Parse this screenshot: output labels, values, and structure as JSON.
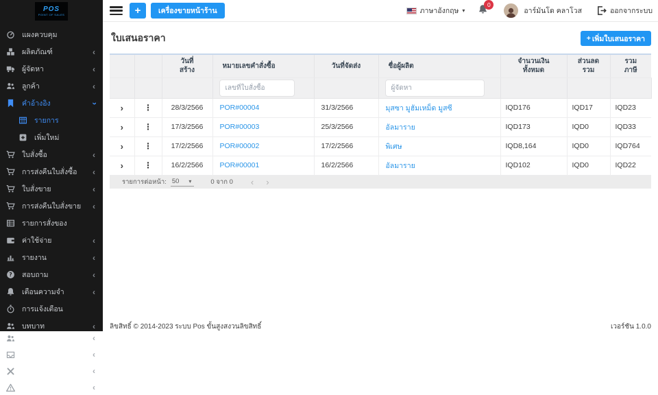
{
  "glyphs": {
    "plus": "+",
    "expand": "›",
    "dots": "⋮",
    "chevron": "‹",
    "caret": "▾",
    "prev": "‹",
    "next": "›"
  },
  "brand": {
    "name": "POS",
    "tagline": "POINT OF SALES"
  },
  "topbar": {
    "pos_terminal_button": "เครื่องขายหน้าร้าน",
    "language_label": "ภาษาอังกฤษ",
    "notification_badge": "0",
    "user_name": "อาร์มันโด คลาโวส",
    "logout_label": "ออกจากระบบ"
  },
  "sidebar": {
    "items": [
      {
        "icon": "dashboard",
        "label": "แผงควบคุม"
      },
      {
        "icon": "products",
        "label": "ผลิตภัณฑ์"
      },
      {
        "icon": "supplier-truck",
        "label": "ผู้จัดหา"
      },
      {
        "icon": "customers",
        "label": "ลูกค้า"
      },
      {
        "icon": "bookmark",
        "label": "คำอ้างอิง",
        "active": true
      },
      {
        "icon": "table",
        "label": "รายการ",
        "active": true,
        "sub": true
      },
      {
        "icon": "plus-square",
        "label": "เพิ่มใหม่",
        "sub": true
      },
      {
        "icon": "cart",
        "label": "ใบสั่งซื้อ"
      },
      {
        "icon": "cart-return",
        "label": "การส่งคืนใบสั่งซื้อ"
      },
      {
        "icon": "cart",
        "label": "ใบสั่งขาย"
      },
      {
        "icon": "cart-return",
        "label": "การส่งคืนใบสั่งขาย"
      },
      {
        "icon": "grid",
        "label": "รายการสั่งของ"
      },
      {
        "icon": "wallet",
        "label": "ค่าใช้จ่าย"
      },
      {
        "icon": "chart",
        "label": "รายงาน"
      },
      {
        "icon": "question",
        "label": "สอบถาม"
      },
      {
        "icon": "bell",
        "label": "เตือนความจำ"
      },
      {
        "icon": "stopwatch",
        "label": "การแจ้งเตือน"
      },
      {
        "icon": "roles",
        "label": "บทบาท"
      },
      {
        "icon": "users",
        "label": ""
      },
      {
        "icon": "mailbox",
        "label": ""
      },
      {
        "icon": "tools",
        "label": ""
      },
      {
        "icon": "warning",
        "label": ""
      }
    ]
  },
  "page": {
    "title": "ใบเสนอราคา",
    "add_button_label": "เพิ่มใบเสนอราคา"
  },
  "table": {
    "headers": {
      "created_l1": "วันที่",
      "created_l2": "สร้าง",
      "order_no": "หมายเลขคำสั่งซื้อ",
      "delivery": "วันที่จัดส่ง",
      "producer": "ชื่อผู้ผลิต",
      "amount_l1": "จำนวนเงิน",
      "amount_l2": "ทั้งหมด",
      "discount_l1": "ส่วนลด",
      "discount_l2": "รวม",
      "tax_l1": "รวม",
      "tax_l2": "ภาษี"
    },
    "filters": {
      "order_no_placeholder": "เลขที่ใบสั่งซื้อ",
      "supplier_placeholder": "ผู้จัดหา"
    },
    "rows": [
      {
        "created": "28/3/2566",
        "order_no": "POR#00004",
        "delivery": "31/3/2566",
        "producer": "มุสซา มูฮัมเหม็ด มูสซี",
        "total": "IQD176",
        "discount": "IQD17",
        "tax": "IQD23"
      },
      {
        "created": "17/3/2566",
        "order_no": "POR#00003",
        "delivery": "25/3/2566",
        "producer": "อัลมาราย",
        "total": "IQD173",
        "discount": "IQD0",
        "tax": "IQD33"
      },
      {
        "created": "17/2/2566",
        "order_no": "POR#00002",
        "delivery": "17/2/2566",
        "producer": "พิเศษ",
        "total": "IQD8,164",
        "discount": "IQD0",
        "tax": "IQD764"
      },
      {
        "created": "16/2/2566",
        "order_no": "POR#00001",
        "delivery": "16/2/2566",
        "producer": "อัลมาราย",
        "total": "IQD102",
        "discount": "IQD0",
        "tax": "IQD22"
      }
    ],
    "pagination": {
      "per_page_label": "รายการต่อหน้า:",
      "per_page_value": "50",
      "range_text": "0 จาก 0"
    }
  },
  "footer": {
    "copyright": "ลิขสิทธิ์ © 2014-2023 ระบบ Pos ขั้นสูงสงวนลิขสิทธิ์",
    "version": "เวอร์ชัน 1.0.0"
  }
}
